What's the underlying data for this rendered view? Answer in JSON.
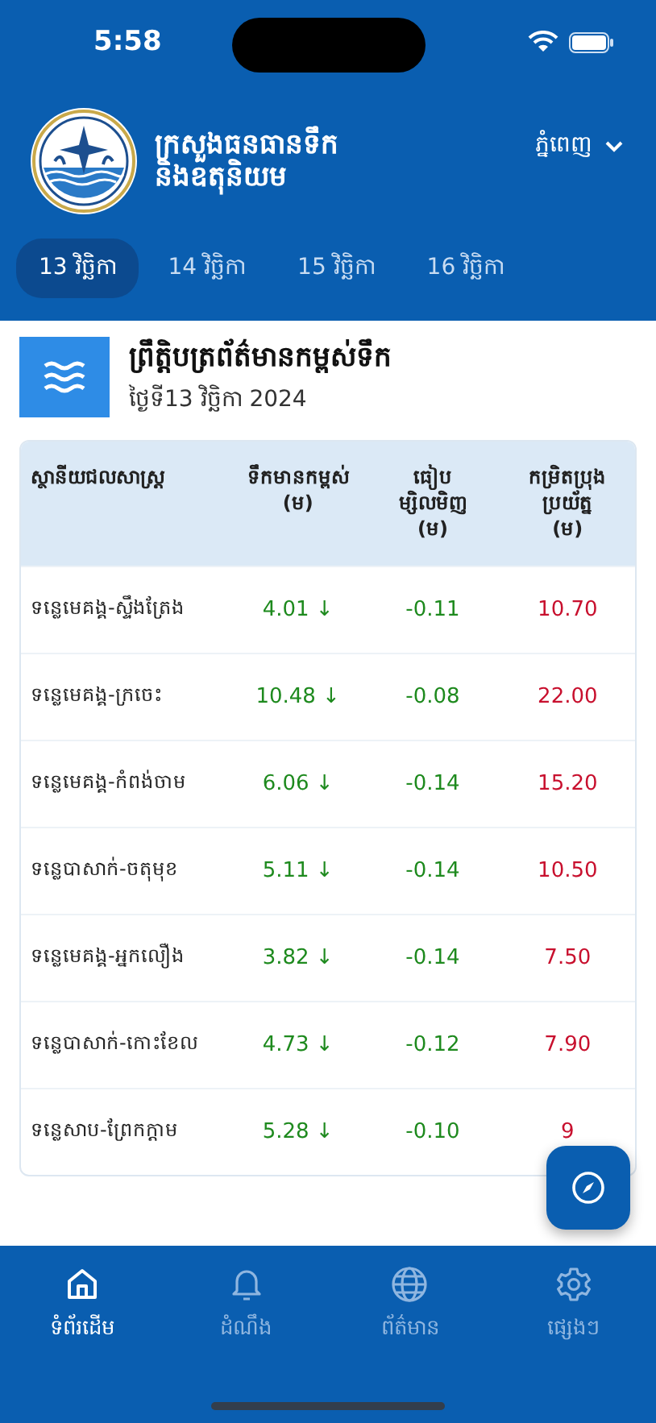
{
  "status_bar": {
    "time": "5:58"
  },
  "header": {
    "title_line_1": "ក្រសួងធនធានទឹក",
    "title_line_2": "និងឧតុនិយម",
    "location": "ភ្នំពេញ"
  },
  "date_tabs": [
    {
      "label": "13 វិច្ឆិកា",
      "selected": true
    },
    {
      "label": "14 វិច្ឆិកា",
      "selected": false
    },
    {
      "label": "15 វិច្ឆិកា",
      "selected": false
    },
    {
      "label": "16 វិច្ឆិកា",
      "selected": false
    }
  ],
  "bulletin": {
    "title": "ព្រឹត្តិបត្រព័ត៌មានកម្ពស់ទឹក",
    "date": "ថ្ងៃទី13 វិច្ឆិកា 2024"
  },
  "table": {
    "columns": [
      {
        "line_1": "ស្ថានីយជលសាស្ត្រ"
      },
      {
        "line_1": "ទឹកមានកម្ពស់",
        "line_2": "(ម)"
      },
      {
        "line_1": "ធៀប",
        "line_2": "ម្សិលមិញ",
        "line_3": "(ម)"
      },
      {
        "line_1": "កម្រិតប្រុង",
        "line_2": "ប្រយ័ត្ន",
        "line_3": "(ម)"
      }
    ],
    "rows": [
      {
        "station": "ទន្លេមេគង្គ-ស្ទឹងត្រែង",
        "water_level": "4.01 ↓",
        "change": "-0.11",
        "alert_level": "10.70"
      },
      {
        "station": "ទន្លេមេគង្គ-ក្រចេះ",
        "water_level": "10.48 ↓",
        "change": "-0.08",
        "alert_level": "22.00"
      },
      {
        "station": "ទន្លេមេគង្គ-កំពង់ចាម",
        "water_level": "6.06 ↓",
        "change": "-0.14",
        "alert_level": "15.20"
      },
      {
        "station": "ទន្លេបាសាក់-ចតុមុខ",
        "water_level": "5.11 ↓",
        "change": "-0.14",
        "alert_level": "10.50"
      },
      {
        "station": "ទន្លេមេគង្គ-អ្នកលឿង",
        "water_level": "3.82 ↓",
        "change": "-0.14",
        "alert_level": "7.50"
      },
      {
        "station": "ទន្លេបាសាក់-កោះខែល",
        "water_level": "4.73 ↓",
        "change": "-0.12",
        "alert_level": "7.90"
      },
      {
        "station": "ទន្លេសាប-ព្រែកក្តាម",
        "water_level": "5.28 ↓",
        "change": "-0.10",
        "alert_level": "9"
      }
    ]
  },
  "bottom_nav": [
    {
      "label": "ទំព័រដើម",
      "kind": "home",
      "selected": true
    },
    {
      "label": "ដំណឹង",
      "kind": "bell",
      "selected": false
    },
    {
      "label": "ព័ត៌មាន",
      "kind": "globe",
      "selected": false
    },
    {
      "label": "ផ្សេងៗ",
      "kind": "gear",
      "selected": false
    }
  ]
}
